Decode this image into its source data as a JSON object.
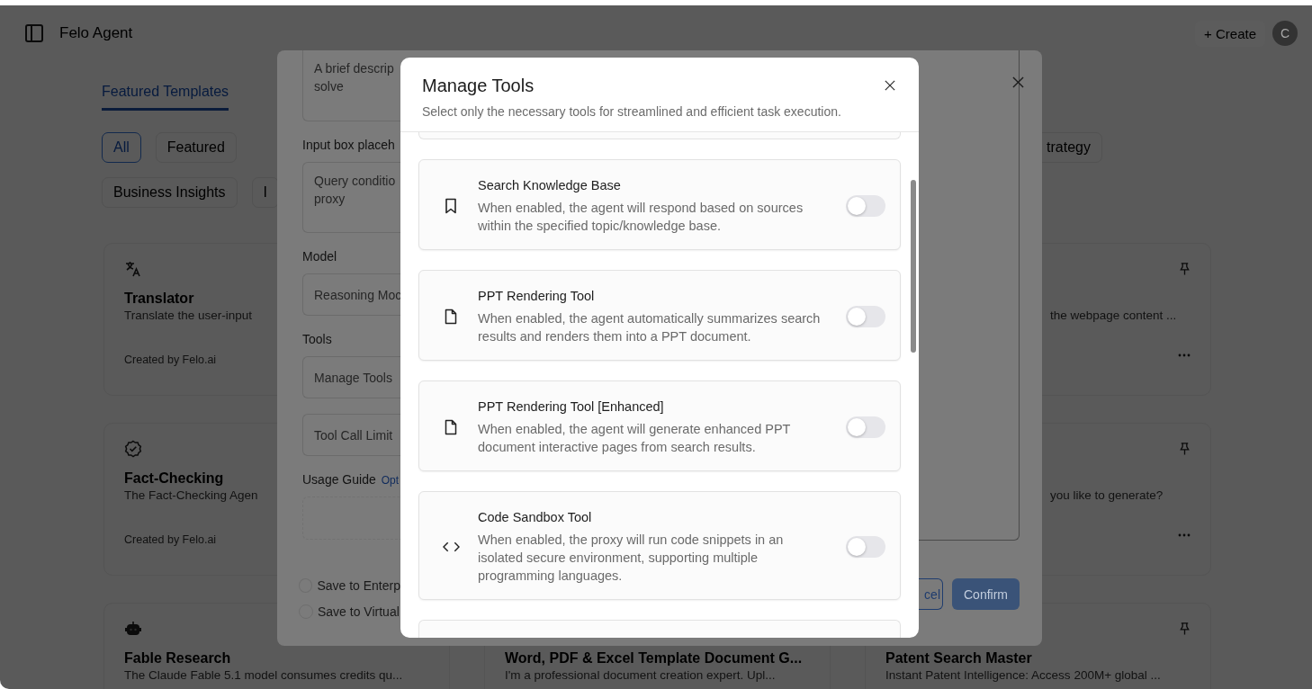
{
  "header": {
    "title": "Felo Agent",
    "create_label": "+ Create",
    "avatar_letter": "C"
  },
  "section_tabs": [
    {
      "label": "Featured Templates",
      "selected": true
    }
  ],
  "filter_chips": [
    [
      {
        "label": "All",
        "selected": true
      },
      {
        "label": "Featured",
        "selected": false
      },
      {
        "label": "trategy",
        "selected": false
      }
    ],
    [
      {
        "label": "Business Insights",
        "selected": false
      },
      {
        "label": "I",
        "selected": false
      }
    ]
  ],
  "template_columns": [
    [
      {
        "kind": "full",
        "title": "Translator",
        "description": "Translate the user-input",
        "footer": "Created by Felo.ai"
      },
      {
        "kind": "full",
        "title": "Fact-Checking",
        "description": "The Fact-Checking Agen",
        "footer": "Created by Felo.ai"
      },
      {
        "kind": "full",
        "title": "Fable Research",
        "description": "The Claude Fable 5.1 model consumes credits qu..."
      }
    ],
    [
      {
        "kind": "full",
        "title": "Word, PDF & Excel Template Document G...",
        "description": "I'm a professional document creation expert. Upl..."
      }
    ],
    [
      {
        "kind": "partial",
        "description": "the webpage content ...",
        "pinned": true,
        "menu": true
      },
      {
        "kind": "partial",
        "description": "you like to generate?",
        "pinned": true,
        "menu": true
      },
      {
        "kind": "full",
        "title": "Patent Search Master",
        "description": "Instant Patent Intelligence: Access 200M+ global ...",
        "pinned": true
      }
    ]
  ],
  "editor_dialog": {
    "fields": [
      {
        "kind": "textarea",
        "placeholder_lines": [
          "A brief descrip",
          "solve"
        ]
      },
      {
        "kind": "label",
        "text": "Input box placeh"
      },
      {
        "kind": "textarea",
        "placeholder_lines": [
          "Query conditio",
          "proxy"
        ]
      },
      {
        "kind": "label",
        "text": "Model"
      },
      {
        "kind": "select",
        "value": "Reasoning Moc"
      },
      {
        "kind": "label",
        "text": "Tools"
      },
      {
        "kind": "select",
        "value": "Manage Tools"
      },
      {
        "kind": "select",
        "value": "Tool Call Limit"
      },
      {
        "kind": "label",
        "text": "Usage Guide",
        "hint": "Opt"
      },
      {
        "kind": "upload"
      }
    ],
    "options": [
      {
        "label": "Save to Enterp",
        "checked": false
      },
      {
        "label": "Save to Virtual",
        "checked": false
      }
    ],
    "buttons": [
      {
        "label": "cel",
        "kind": "secondary"
      },
      {
        "label": "Confirm",
        "kind": "primary"
      }
    ]
  },
  "manage_tools_dialog": {
    "title": "Manage Tools",
    "subtitle": "Select only the necessary tools for streamlined and efficient task execution.",
    "tools": [
      {
        "name": "Search Knowledge Base",
        "description": "When enabled, the agent will respond based on sources within the specified topic/knowledge base.",
        "enabled": false
      },
      {
        "name": "PPT Rendering Tool",
        "description": "When enabled, the agent automatically summarizes search results and renders them into a PPT document.",
        "enabled": false
      },
      {
        "name": "PPT Rendering Tool [Enhanced]",
        "description": "When enabled, the agent will generate enhanced PPT document interactive pages from search results.",
        "enabled": false
      },
      {
        "name": "Code Sandbox Tool",
        "description": "When enabled, the proxy will run code snippets in an isolated secure environment, supporting multiple programming languages.",
        "enabled": false
      }
    ]
  }
}
